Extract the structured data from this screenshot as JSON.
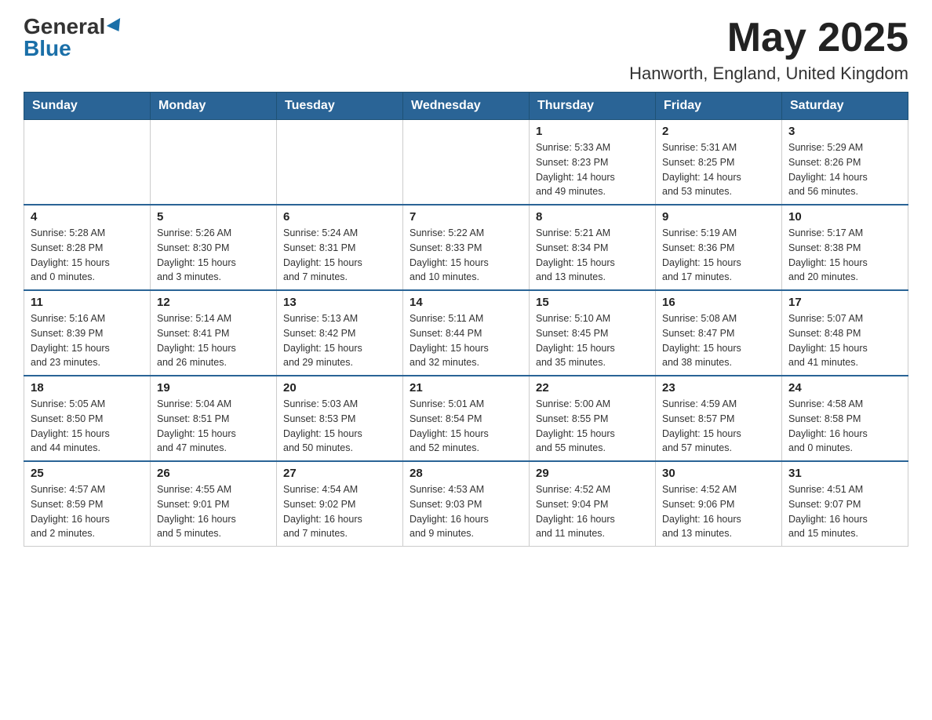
{
  "header": {
    "logo_general": "General",
    "logo_blue": "Blue",
    "month_year": "May 2025",
    "location": "Hanworth, England, United Kingdom"
  },
  "days_of_week": [
    "Sunday",
    "Monday",
    "Tuesday",
    "Wednesday",
    "Thursday",
    "Friday",
    "Saturday"
  ],
  "weeks": [
    {
      "days": [
        {
          "num": "",
          "info": ""
        },
        {
          "num": "",
          "info": ""
        },
        {
          "num": "",
          "info": ""
        },
        {
          "num": "",
          "info": ""
        },
        {
          "num": "1",
          "info": "Sunrise: 5:33 AM\nSunset: 8:23 PM\nDaylight: 14 hours\nand 49 minutes."
        },
        {
          "num": "2",
          "info": "Sunrise: 5:31 AM\nSunset: 8:25 PM\nDaylight: 14 hours\nand 53 minutes."
        },
        {
          "num": "3",
          "info": "Sunrise: 5:29 AM\nSunset: 8:26 PM\nDaylight: 14 hours\nand 56 minutes."
        }
      ]
    },
    {
      "days": [
        {
          "num": "4",
          "info": "Sunrise: 5:28 AM\nSunset: 8:28 PM\nDaylight: 15 hours\nand 0 minutes."
        },
        {
          "num": "5",
          "info": "Sunrise: 5:26 AM\nSunset: 8:30 PM\nDaylight: 15 hours\nand 3 minutes."
        },
        {
          "num": "6",
          "info": "Sunrise: 5:24 AM\nSunset: 8:31 PM\nDaylight: 15 hours\nand 7 minutes."
        },
        {
          "num": "7",
          "info": "Sunrise: 5:22 AM\nSunset: 8:33 PM\nDaylight: 15 hours\nand 10 minutes."
        },
        {
          "num": "8",
          "info": "Sunrise: 5:21 AM\nSunset: 8:34 PM\nDaylight: 15 hours\nand 13 minutes."
        },
        {
          "num": "9",
          "info": "Sunrise: 5:19 AM\nSunset: 8:36 PM\nDaylight: 15 hours\nand 17 minutes."
        },
        {
          "num": "10",
          "info": "Sunrise: 5:17 AM\nSunset: 8:38 PM\nDaylight: 15 hours\nand 20 minutes."
        }
      ]
    },
    {
      "days": [
        {
          "num": "11",
          "info": "Sunrise: 5:16 AM\nSunset: 8:39 PM\nDaylight: 15 hours\nand 23 minutes."
        },
        {
          "num": "12",
          "info": "Sunrise: 5:14 AM\nSunset: 8:41 PM\nDaylight: 15 hours\nand 26 minutes."
        },
        {
          "num": "13",
          "info": "Sunrise: 5:13 AM\nSunset: 8:42 PM\nDaylight: 15 hours\nand 29 minutes."
        },
        {
          "num": "14",
          "info": "Sunrise: 5:11 AM\nSunset: 8:44 PM\nDaylight: 15 hours\nand 32 minutes."
        },
        {
          "num": "15",
          "info": "Sunrise: 5:10 AM\nSunset: 8:45 PM\nDaylight: 15 hours\nand 35 minutes."
        },
        {
          "num": "16",
          "info": "Sunrise: 5:08 AM\nSunset: 8:47 PM\nDaylight: 15 hours\nand 38 minutes."
        },
        {
          "num": "17",
          "info": "Sunrise: 5:07 AM\nSunset: 8:48 PM\nDaylight: 15 hours\nand 41 minutes."
        }
      ]
    },
    {
      "days": [
        {
          "num": "18",
          "info": "Sunrise: 5:05 AM\nSunset: 8:50 PM\nDaylight: 15 hours\nand 44 minutes."
        },
        {
          "num": "19",
          "info": "Sunrise: 5:04 AM\nSunset: 8:51 PM\nDaylight: 15 hours\nand 47 minutes."
        },
        {
          "num": "20",
          "info": "Sunrise: 5:03 AM\nSunset: 8:53 PM\nDaylight: 15 hours\nand 50 minutes."
        },
        {
          "num": "21",
          "info": "Sunrise: 5:01 AM\nSunset: 8:54 PM\nDaylight: 15 hours\nand 52 minutes."
        },
        {
          "num": "22",
          "info": "Sunrise: 5:00 AM\nSunset: 8:55 PM\nDaylight: 15 hours\nand 55 minutes."
        },
        {
          "num": "23",
          "info": "Sunrise: 4:59 AM\nSunset: 8:57 PM\nDaylight: 15 hours\nand 57 minutes."
        },
        {
          "num": "24",
          "info": "Sunrise: 4:58 AM\nSunset: 8:58 PM\nDaylight: 16 hours\nand 0 minutes."
        }
      ]
    },
    {
      "days": [
        {
          "num": "25",
          "info": "Sunrise: 4:57 AM\nSunset: 8:59 PM\nDaylight: 16 hours\nand 2 minutes."
        },
        {
          "num": "26",
          "info": "Sunrise: 4:55 AM\nSunset: 9:01 PM\nDaylight: 16 hours\nand 5 minutes."
        },
        {
          "num": "27",
          "info": "Sunrise: 4:54 AM\nSunset: 9:02 PM\nDaylight: 16 hours\nand 7 minutes."
        },
        {
          "num": "28",
          "info": "Sunrise: 4:53 AM\nSunset: 9:03 PM\nDaylight: 16 hours\nand 9 minutes."
        },
        {
          "num": "29",
          "info": "Sunrise: 4:52 AM\nSunset: 9:04 PM\nDaylight: 16 hours\nand 11 minutes."
        },
        {
          "num": "30",
          "info": "Sunrise: 4:52 AM\nSunset: 9:06 PM\nDaylight: 16 hours\nand 13 minutes."
        },
        {
          "num": "31",
          "info": "Sunrise: 4:51 AM\nSunset: 9:07 PM\nDaylight: 16 hours\nand 15 minutes."
        }
      ]
    }
  ]
}
